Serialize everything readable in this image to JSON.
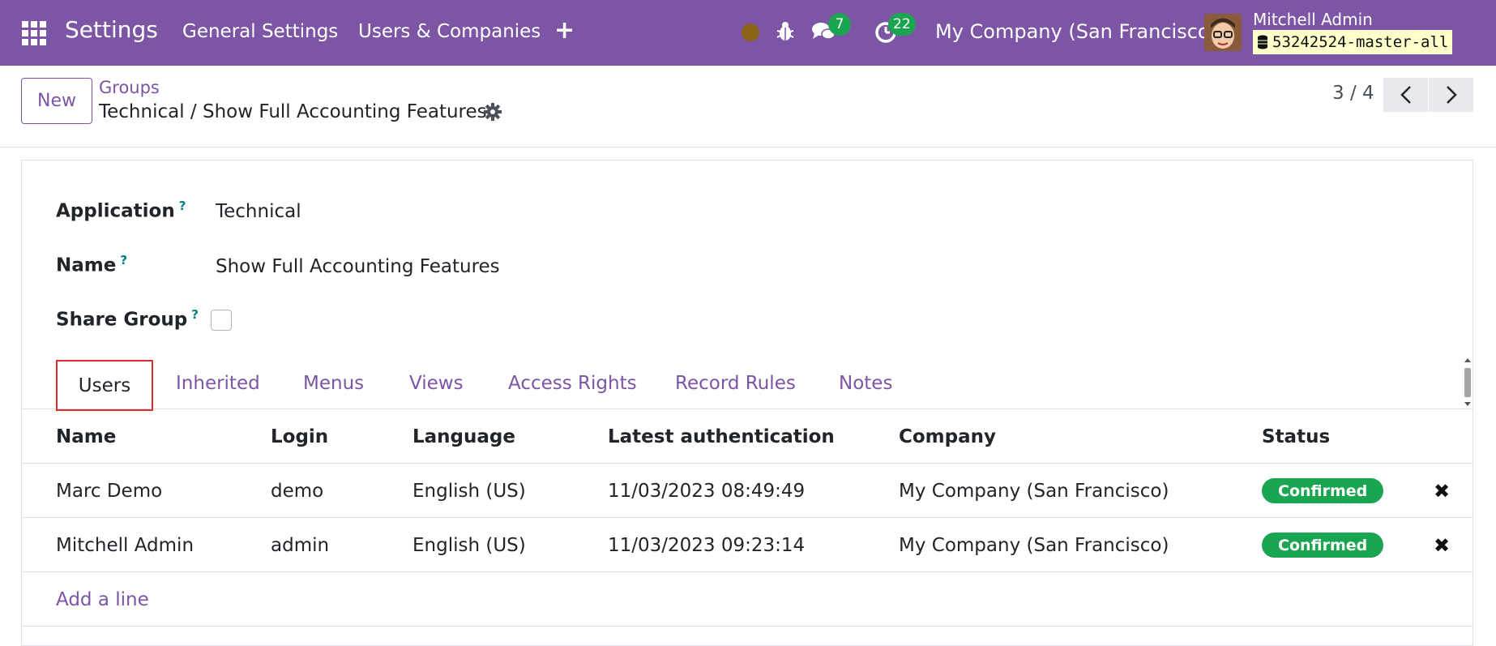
{
  "navbar": {
    "app_name": "Settings",
    "menus": [
      "General Settings",
      "Users & Companies"
    ],
    "add_symbol": "+",
    "chat_count": "7",
    "activity_count": "22",
    "company": "My Company (San Francisco)",
    "user_name": "Mitchell Admin",
    "database": "53242524-master-all",
    "accent_color": "#7c55a5"
  },
  "control_panel": {
    "new_label": "New",
    "breadcrumb_parent": "Groups",
    "breadcrumb_current": "Technical / Show Full Accounting Features",
    "pager": "3 / 4"
  },
  "form": {
    "application_label": "Application",
    "application_value": "Technical",
    "name_label": "Name",
    "name_value": "Show Full Accounting Features",
    "share_group_label": "Share Group",
    "share_group_checked": false,
    "help_symbol": "?"
  },
  "tabs": {
    "items": [
      "Users",
      "Inherited",
      "Menus",
      "Views",
      "Access Rights",
      "Record Rules",
      "Notes"
    ],
    "active": "Users"
  },
  "table": {
    "columns": [
      "Name",
      "Login",
      "Language",
      "Latest authentication",
      "Company",
      "Status"
    ],
    "rows": [
      {
        "name": "Marc Demo",
        "login": "demo",
        "language": "English (US)",
        "latest_auth": "11/03/2023 08:49:49",
        "company": "My Company (San Francisco)",
        "status": "Confirmed"
      },
      {
        "name": "Mitchell Admin",
        "login": "admin",
        "language": "English (US)",
        "latest_auth": "11/03/2023 09:23:14",
        "company": "My Company (San Francisco)",
        "status": "Confirmed"
      }
    ],
    "remove_symbol": "✖",
    "add_line_label": "Add a line",
    "status_color": "#1aa551"
  }
}
